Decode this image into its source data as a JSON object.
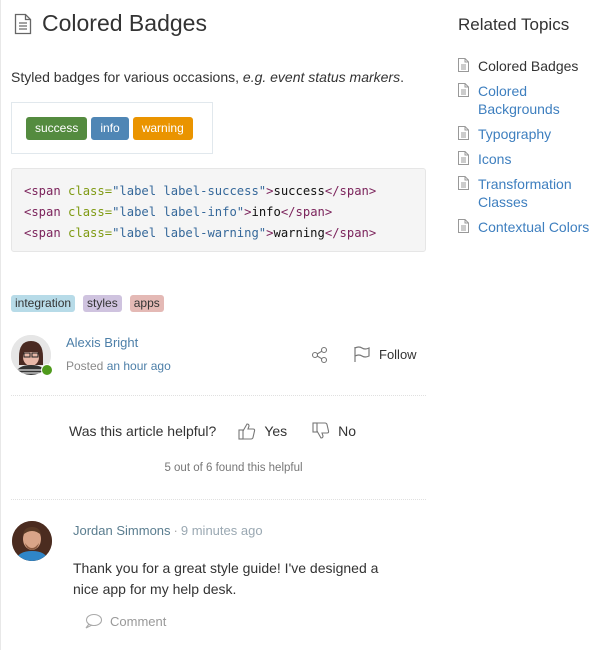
{
  "article": {
    "icon": "document-icon",
    "title": "Colored Badges",
    "intro_plain": "Styled badges for various occasions, ",
    "intro_italic": "e.g. event status markers",
    "intro_end": ".",
    "badges": [
      {
        "label": "success",
        "color": "#548b3f"
      },
      {
        "label": "info",
        "color": "#4f86b5"
      },
      {
        "label": "warning",
        "color": "#ea9400"
      }
    ],
    "code": [
      {
        "open": "<span",
        "attr": " class=",
        "str": "\"label label-success\"",
        "close": ">",
        "text": "success",
        "end": "</span>"
      },
      {
        "open": "<span",
        "attr": " class=",
        "str": "\"label label-info\"",
        "close": ">",
        "text": "info",
        "end": "</span>"
      },
      {
        "open": "<span",
        "attr": " class=",
        "str": "\"label label-warning\"",
        "close": ">",
        "text": "warning",
        "end": "</span>"
      }
    ],
    "tags": [
      "integration",
      "styles",
      "apps"
    ]
  },
  "author": {
    "name": "Alexis Bright",
    "posted_prefix": "Posted ",
    "posted_time": "an hour ago",
    "status": "online",
    "share_icon": "share-icon",
    "follow_label": "Follow"
  },
  "feedback": {
    "question": "Was this article helpful?",
    "yes_label": "Yes",
    "no_label": "No",
    "summary": "5 out of 6 found this helpful"
  },
  "comments": [
    {
      "author": "Jordan Simmons",
      "separator": "·",
      "time": "9 minutes ago",
      "body": "Thank you for a great style guide! I've designed a nice app for my help desk.",
      "action_label": "Comment"
    }
  ],
  "sidebar": {
    "title": "Related Topics",
    "items": [
      {
        "label": "Colored Badges",
        "current": true
      },
      {
        "label": "Colored Backgrounds",
        "current": false
      },
      {
        "label": "Typography",
        "current": false
      },
      {
        "label": "Icons",
        "current": false
      },
      {
        "label": "Transformation Classes",
        "current": false
      },
      {
        "label": "Contextual Colors",
        "current": false
      }
    ]
  }
}
